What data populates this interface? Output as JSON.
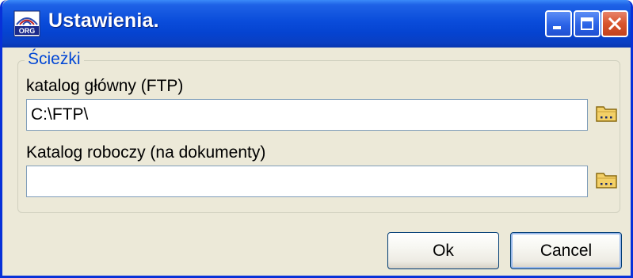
{
  "window": {
    "title": "Ustawienia.",
    "app_icon": "org-app-icon",
    "controls": {
      "minimize": "minimize-icon",
      "maximize": "maximize-icon",
      "close": "close-icon"
    }
  },
  "paths_group": {
    "legend": "Ścieżki",
    "root_dir": {
      "label": "katalog główny (FTP)",
      "value": "C:\\FTP\\",
      "browse_icon": "folder-browse-icon"
    },
    "work_dir": {
      "label": "Katalog roboczy (na dokumenty)",
      "value": "",
      "browse_icon": "folder-browse-icon"
    }
  },
  "buttons": {
    "ok": "Ok",
    "cancel": "Cancel"
  },
  "colors": {
    "titlebar": "#0A4CDA",
    "dialog_bg": "#ECE9D8",
    "legend_text": "#0046D5",
    "close_button": "#D8542C"
  }
}
